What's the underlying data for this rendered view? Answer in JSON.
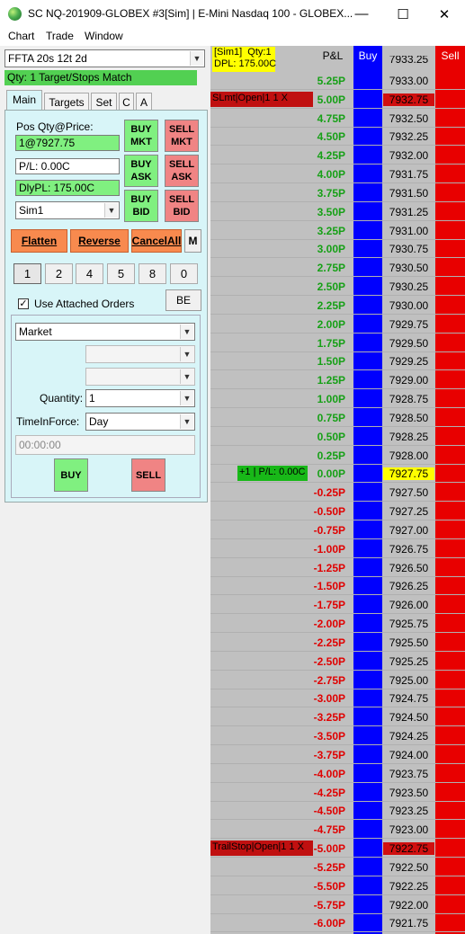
{
  "window": {
    "title": "SC NQ-201909-GLOBEX  #3[Sim]  | E-Mini Nasdaq 100 - GLOBEX...",
    "min_glyph": "—",
    "max_glyph": "☐",
    "close_glyph": "✕"
  },
  "menu": [
    "Chart",
    "Trade",
    "Window"
  ],
  "left_panel": {
    "strategy_select": "FFTA 20s 12t  2d",
    "qty_status": "Qty: 1 Target/Stops Match",
    "tabs": [
      "Main",
      "Targets",
      "Set",
      "C",
      "A"
    ],
    "pos_label": "Pos Qty@Price:",
    "pos_value": "1@7927.75",
    "pl_value": "P/L: 0.00C",
    "dly_pl_value": "DlyPL: 175.00C",
    "account": "Sim1",
    "buttons": {
      "buy_mkt": "BUY\nMKT",
      "sell_mkt": "SELL\nMKT",
      "buy_ask": "BUY\nASK",
      "sell_ask": "SELL\nASK",
      "buy_bid": "BUY\nBID",
      "sell_bid": "SELL\nBID",
      "flatten": "Flatten",
      "reverse": "Reverse",
      "cancel_all": "CancelAll",
      "m": "M",
      "be": "BE",
      "buy": "BUY",
      "sell": "SELL"
    },
    "quantities": [
      "1",
      "2",
      "4",
      "5",
      "8",
      "0"
    ],
    "use_attached_orders": "Use Attached Orders",
    "order_type": "Market",
    "quantity_label": "Quantity:",
    "quantity_value": "1",
    "tif_label": "TimeInForce:",
    "tif_value": "Day",
    "time_value": "00:00:00"
  },
  "ladder": {
    "header": {
      "info": "[Sim1]  Qty:1\nDPL: 175.00C",
      "pnl": "P&L",
      "buy": "Buy",
      "sell": "Sell",
      "price_partial": "7933.25"
    },
    "colors": {
      "buy_col": "#0000fe",
      "sell_col": "#e80000",
      "background": "#c0c0c0"
    },
    "rows": [
      {
        "pnl": "5.25P",
        "price": "7933.00"
      },
      {
        "pnl": "5.00P",
        "price": "7932.75",
        "order": "SLmt|Open|1  1  X",
        "price_hl": "red"
      },
      {
        "pnl": "4.75P",
        "price": "7932.50"
      },
      {
        "pnl": "4.50P",
        "price": "7932.25"
      },
      {
        "pnl": "4.25P",
        "price": "7932.00"
      },
      {
        "pnl": "4.00P",
        "price": "7931.75"
      },
      {
        "pnl": "3.75P",
        "price": "7931.50"
      },
      {
        "pnl": "3.50P",
        "price": "7931.25"
      },
      {
        "pnl": "3.25P",
        "price": "7931.00"
      },
      {
        "pnl": "3.00P",
        "price": "7930.75"
      },
      {
        "pnl": "2.75P",
        "price": "7930.50"
      },
      {
        "pnl": "2.50P",
        "price": "7930.25"
      },
      {
        "pnl": "2.25P",
        "price": "7930.00"
      },
      {
        "pnl": "2.00P",
        "price": "7929.75"
      },
      {
        "pnl": "1.75P",
        "price": "7929.50"
      },
      {
        "pnl": "1.50P",
        "price": "7929.25"
      },
      {
        "pnl": "1.25P",
        "price": "7929.00"
      },
      {
        "pnl": "1.00P",
        "price": "7928.75"
      },
      {
        "pnl": "0.75P",
        "price": "7928.50"
      },
      {
        "pnl": "0.50P",
        "price": "7928.25"
      },
      {
        "pnl": "0.25P",
        "price": "7928.00"
      },
      {
        "pnl": "0.00P",
        "price": "7927.75",
        "position": "+1 | P/L: 0.00C",
        "price_hl": "yellow"
      },
      {
        "pnl": "-0.25P",
        "price": "7927.50"
      },
      {
        "pnl": "-0.50P",
        "price": "7927.25"
      },
      {
        "pnl": "-0.75P",
        "price": "7927.00"
      },
      {
        "pnl": "-1.00P",
        "price": "7926.75"
      },
      {
        "pnl": "-1.25P",
        "price": "7926.50"
      },
      {
        "pnl": "-1.50P",
        "price": "7926.25"
      },
      {
        "pnl": "-1.75P",
        "price": "7926.00"
      },
      {
        "pnl": "-2.00P",
        "price": "7925.75"
      },
      {
        "pnl": "-2.25P",
        "price": "7925.50"
      },
      {
        "pnl": "-2.50P",
        "price": "7925.25"
      },
      {
        "pnl": "-2.75P",
        "price": "7925.00"
      },
      {
        "pnl": "-3.00P",
        "price": "7924.75"
      },
      {
        "pnl": "-3.25P",
        "price": "7924.50"
      },
      {
        "pnl": "-3.50P",
        "price": "7924.25"
      },
      {
        "pnl": "-3.75P",
        "price": "7924.00"
      },
      {
        "pnl": "-4.00P",
        "price": "7923.75"
      },
      {
        "pnl": "-4.25P",
        "price": "7923.50"
      },
      {
        "pnl": "-4.50P",
        "price": "7923.25"
      },
      {
        "pnl": "-4.75P",
        "price": "7923.00"
      },
      {
        "pnl": "-5.00P",
        "price": "7922.75",
        "order": "TrailStop|Open|1  1  X",
        "price_hl": "red"
      },
      {
        "pnl": "-5.25P",
        "price": "7922.50"
      },
      {
        "pnl": "-5.50P",
        "price": "7922.25"
      },
      {
        "pnl": "-5.75P",
        "price": "7922.00"
      },
      {
        "pnl": "-6.00P",
        "price": "7921.75"
      }
    ]
  }
}
